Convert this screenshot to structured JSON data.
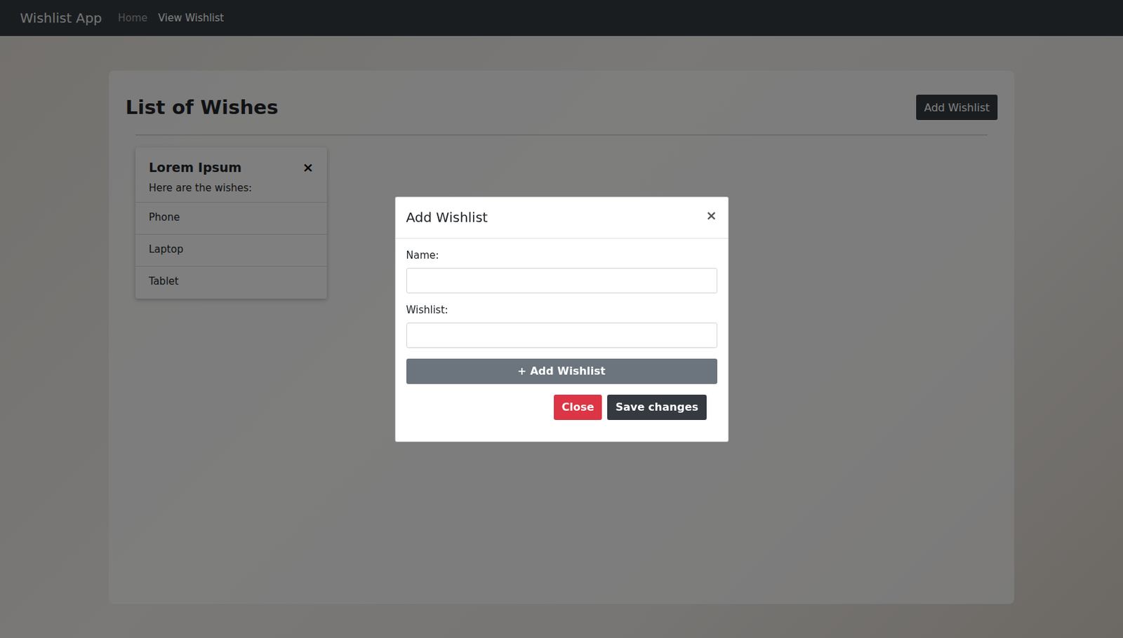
{
  "navbar": {
    "brand": "Wishlist App",
    "links": [
      {
        "label": "Home",
        "selected": false
      },
      {
        "label": "View Wishlist",
        "selected": true
      }
    ]
  },
  "page": {
    "title": "List of Wishes",
    "add_button": "Add Wishlist"
  },
  "wishlists": [
    {
      "name": "Lorem Ipsum",
      "close": "×",
      "subtitle": "Here are the wishes:",
      "items": [
        "Phone",
        "Laptop",
        "Tablet"
      ]
    }
  ],
  "modal": {
    "title": "Add Wishlist",
    "close": "×",
    "fields": [
      {
        "label": "Name:",
        "value": ""
      },
      {
        "label": "Wishlist:",
        "value": ""
      }
    ],
    "add_item_button": "+ Add Wishlist",
    "buttons": [
      {
        "label": "Close",
        "kind": "danger"
      },
      {
        "label": "Save changes",
        "kind": "primary"
      }
    ]
  }
}
